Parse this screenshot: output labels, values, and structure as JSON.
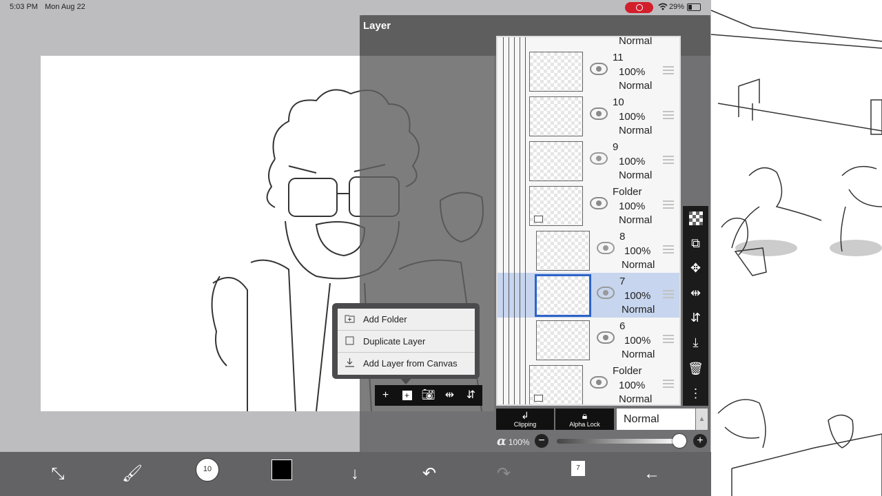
{
  "status_bar": {
    "time": "5:03 PM",
    "date": "Mon Aug 22",
    "battery": "29%"
  },
  "layer_panel": {
    "title": "Layer",
    "top_partial_mode": "Normal",
    "layers": [
      {
        "name": "11",
        "opacity": "100%",
        "mode": "Normal",
        "type": "layer",
        "selected": false
      },
      {
        "name": "10",
        "opacity": "100%",
        "mode": "Normal",
        "type": "layer",
        "selected": false
      },
      {
        "name": "9",
        "opacity": "100%",
        "mode": "Normal",
        "type": "layer",
        "selected": false
      },
      {
        "name": "Folder",
        "opacity": "100%",
        "mode": "Normal",
        "type": "folder",
        "selected": false
      },
      {
        "name": "8",
        "opacity": "100%",
        "mode": "Normal",
        "type": "layer",
        "selected": false
      },
      {
        "name": "7",
        "opacity": "100%",
        "mode": "Normal",
        "type": "layer",
        "selected": true
      },
      {
        "name": "6",
        "opacity": "100%",
        "mode": "Normal",
        "type": "layer",
        "selected": false
      },
      {
        "name": "Folder",
        "opacity": "100%",
        "mode": "Normal",
        "type": "folder",
        "selected": false
      }
    ],
    "clipping_label": "Clipping",
    "alpha_lock_label": "Alpha Lock",
    "blend_mode": "Normal",
    "alpha_label": "100%"
  },
  "popup_menu": {
    "items": [
      {
        "label": "Add Folder",
        "icon": "folder-plus-icon"
      },
      {
        "label": "Duplicate Layer",
        "icon": "duplicate-icon"
      },
      {
        "label": "Add Layer from Canvas",
        "icon": "download-icon"
      }
    ]
  },
  "bottom_toolbar": {
    "brush_size": "10",
    "layer_count": "7"
  }
}
